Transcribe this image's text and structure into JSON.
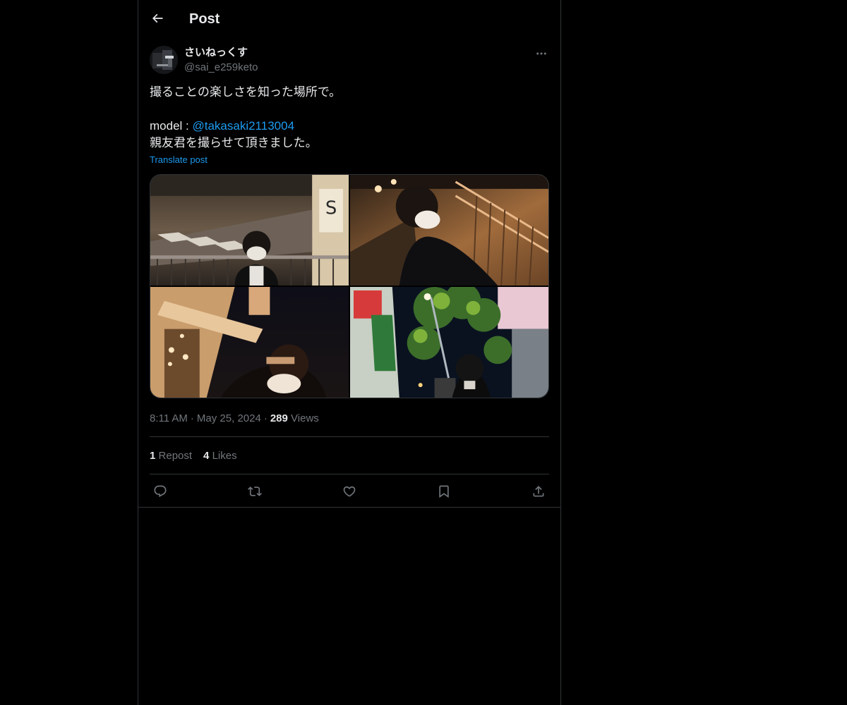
{
  "header": {
    "title": "Post",
    "back_icon": "arrow-left-icon"
  },
  "author": {
    "display_name": "さいねっくす",
    "handle": "@sai_e259keto",
    "more_icon": "more-horizontal-icon"
  },
  "post": {
    "line1": "撮ることの楽しさを知った場所で。",
    "model_prefix": "model : ",
    "mention": "@takasaki2113004",
    "line3": "親友君を撮らせて頂きました。",
    "translate_label": "Translate post"
  },
  "media": {
    "photos": [
      "night-crosswalk-photo",
      "railing-portrait-photo",
      "low-angle-portrait-photo",
      "street-trees-photo"
    ]
  },
  "meta": {
    "time": "8:11 AM",
    "date": "May 25, 2024",
    "views_count": "289",
    "views_label": "Views",
    "separator": "·"
  },
  "stats": {
    "reposts_count": "1",
    "reposts_label": "Repost",
    "likes_count": "4",
    "likes_label": "Likes"
  },
  "actions": {
    "reply_icon": "reply-icon",
    "repost_icon": "repost-icon",
    "like_icon": "heart-icon",
    "bookmark_icon": "bookmark-icon",
    "share_icon": "share-icon"
  },
  "colors": {
    "background": "#000000",
    "text": "#e7e9ea",
    "muted": "#71767b",
    "accent": "#1d9bf0",
    "border": "#2f3336"
  }
}
